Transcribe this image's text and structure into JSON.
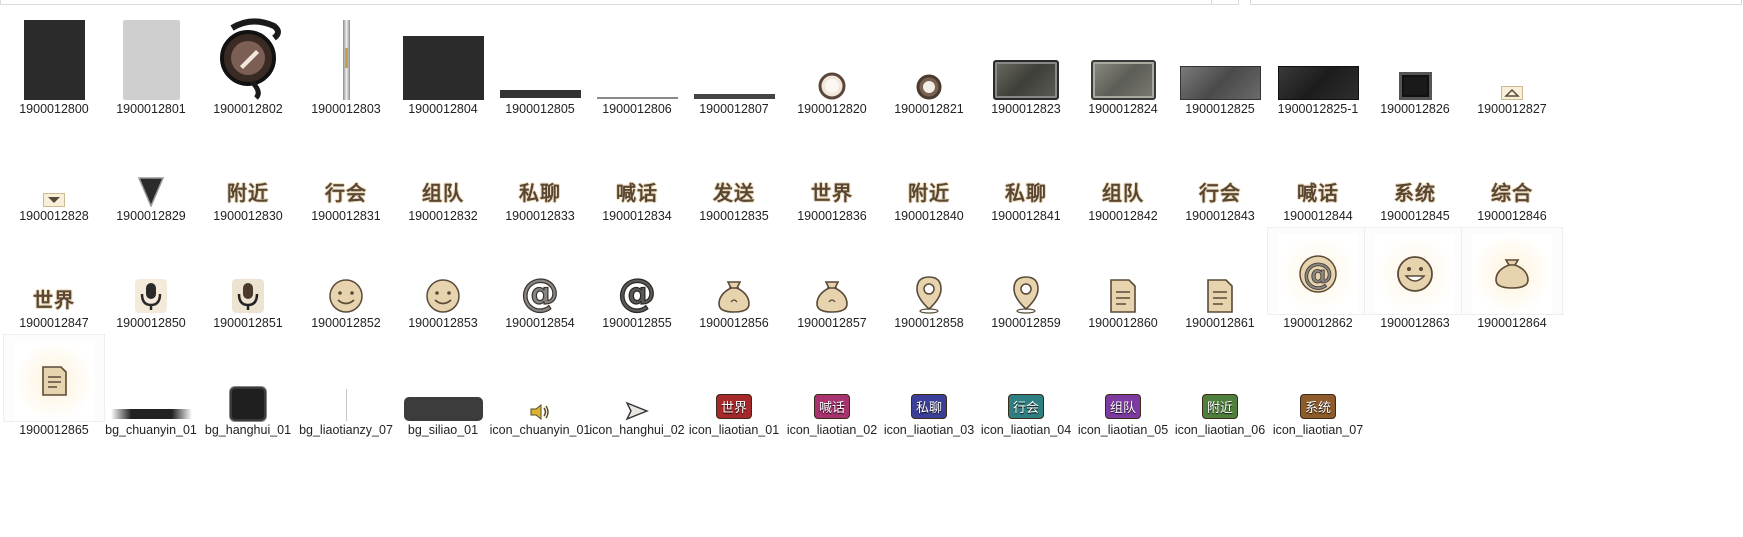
{
  "colors": {
    "dark_panel": "#2b2b2b",
    "gray_panel": "#cfcfcf",
    "beige_icon": "#e7d3ad",
    "icon_outline": "#5a4a38",
    "badge_world": "#a5282b",
    "badge_shout": "#a8336f",
    "badge_private": "#3a3f9a",
    "badge_guild": "#2e7f82",
    "badge_team": "#7d3aa1",
    "badge_nearby": "#4f7f3c",
    "badge_system": "#8e5b2a"
  },
  "files": [
    {
      "name": "1900012800",
      "kind": "dark-panel",
      "icon": "dark-square-image"
    },
    {
      "name": "1900012801",
      "kind": "gray-panel",
      "icon": "gray-square-image"
    },
    {
      "name": "1900012802",
      "kind": "orb",
      "icon": "pencil-orb-icon"
    },
    {
      "name": "1900012803",
      "kind": "vbar",
      "icon": "vertical-slider-bar-image"
    },
    {
      "name": "1900012804",
      "kind": "dark-rect",
      "icon": "dark-rectangle-image"
    },
    {
      "name": "1900012805",
      "kind": "thick-line",
      "icon": "dark-bar-image"
    },
    {
      "name": "1900012806",
      "kind": "thin-line",
      "icon": "thin-line-image"
    },
    {
      "name": "1900012807",
      "kind": "mid-line",
      "icon": "line-image"
    },
    {
      "name": "1900012820",
      "kind": "ring-light",
      "icon": "round-button-icon"
    },
    {
      "name": "1900012821",
      "kind": "ring-dark",
      "icon": "round-button-icon"
    },
    {
      "name": "1900012823",
      "kind": "plate1",
      "icon": "metal-plate-image"
    },
    {
      "name": "1900012824",
      "kind": "plate2",
      "icon": "metal-plate-image"
    },
    {
      "name": "1900012825",
      "kind": "plate3",
      "icon": "metal-plate-image"
    },
    {
      "name": "1900012825-1",
      "kind": "plate4",
      "icon": "metal-plate-image"
    },
    {
      "name": "1900012826",
      "kind": "frame",
      "icon": "square-frame-image"
    },
    {
      "name": "1900012827",
      "kind": "arrow-up",
      "icon": "arrow-up-icon"
    },
    {
      "name": "1900012828",
      "kind": "arrow-down",
      "icon": "arrow-down-icon"
    },
    {
      "name": "1900012829",
      "kind": "triangle",
      "icon": "triangle-down-icon"
    },
    {
      "name": "1900012830",
      "kind": "gold",
      "text": "附近",
      "icon": "nearby-text-image"
    },
    {
      "name": "1900012831",
      "kind": "gold",
      "text": "行会",
      "icon": "guild-text-image"
    },
    {
      "name": "1900012832",
      "kind": "gold",
      "text": "组队",
      "icon": "team-text-image"
    },
    {
      "name": "1900012833",
      "kind": "gold",
      "text": "私聊",
      "icon": "private-chat-text-image"
    },
    {
      "name": "1900012834",
      "kind": "gold",
      "text": "喊话",
      "icon": "shout-text-image"
    },
    {
      "name": "1900012835",
      "kind": "gold",
      "text": "发送",
      "icon": "send-text-image"
    },
    {
      "name": "1900012836",
      "kind": "gold",
      "text": "世界",
      "icon": "world-text-image"
    },
    {
      "name": "1900012840",
      "kind": "gold",
      "text": "附近",
      "icon": "nearby-text-image"
    },
    {
      "name": "1900012841",
      "kind": "gold",
      "text": "私聊",
      "icon": "private-chat-text-image"
    },
    {
      "name": "1900012842",
      "kind": "gold",
      "text": "组队",
      "icon": "team-text-image"
    },
    {
      "name": "1900012843",
      "kind": "gold",
      "text": "行会",
      "icon": "guild-text-image"
    },
    {
      "name": "1900012844",
      "kind": "gold",
      "text": "喊话",
      "icon": "shout-text-image"
    },
    {
      "name": "1900012845",
      "kind": "gold",
      "text": "系统",
      "icon": "system-text-image"
    },
    {
      "name": "1900012846",
      "kind": "gold",
      "text": "综合",
      "icon": "general-text-image"
    },
    {
      "name": "1900012847",
      "kind": "gold",
      "text": "世界",
      "icon": "world-text-image"
    },
    {
      "name": "1900012850",
      "kind": "mic-light",
      "icon": "microphone-icon"
    },
    {
      "name": "1900012851",
      "kind": "mic-dark",
      "icon": "microphone-icon"
    },
    {
      "name": "1900012852",
      "kind": "smile",
      "icon": "smiley-icon"
    },
    {
      "name": "1900012853",
      "kind": "smile",
      "icon": "smiley-icon"
    },
    {
      "name": "1900012854",
      "kind": "at-light",
      "icon": "at-sign-icon"
    },
    {
      "name": "1900012855",
      "kind": "at-dark",
      "icon": "at-sign-icon"
    },
    {
      "name": "1900012856",
      "kind": "bag",
      "icon": "money-bag-icon"
    },
    {
      "name": "1900012857",
      "kind": "bag",
      "icon": "money-bag-icon"
    },
    {
      "name": "1900012858",
      "kind": "pin",
      "icon": "location-pin-icon"
    },
    {
      "name": "1900012859",
      "kind": "pin",
      "icon": "location-pin-icon"
    },
    {
      "name": "1900012860",
      "kind": "doc",
      "icon": "document-icon"
    },
    {
      "name": "1900012861",
      "kind": "doc",
      "icon": "document-icon"
    },
    {
      "name": "1900012862",
      "kind": "big-at",
      "icon": "at-sign-icon",
      "selected": true
    },
    {
      "name": "1900012863",
      "kind": "big-grin",
      "icon": "grinning-face-icon",
      "selected": true
    },
    {
      "name": "1900012864",
      "kind": "big-bag",
      "icon": "money-bag-icon",
      "selected": true
    },
    {
      "name": "1900012865",
      "kind": "big-doc",
      "icon": "document-icon",
      "selected": true
    },
    {
      "name": "bg_chuanyin_01",
      "kind": "fade-bar",
      "icon": "fade-bar-image"
    },
    {
      "name": "bg_hanghui_01",
      "kind": "dark-box",
      "icon": "dark-box-image"
    },
    {
      "name": "bg_liaotianzy_07",
      "kind": "hairline",
      "icon": "vertical-line-image"
    },
    {
      "name": "bg_siliao_01",
      "kind": "pill",
      "icon": "rounded-panel-image"
    },
    {
      "name": "icon_chuanyin_01",
      "kind": "speaker",
      "icon": "speaker-icon"
    },
    {
      "name": "icon_hanghui_02",
      "kind": "send",
      "icon": "send-arrow-icon"
    },
    {
      "name": "icon_liaotian_01",
      "kind": "badge",
      "text": "世界",
      "color": "#a5282b",
      "icon": "world-badge-icon"
    },
    {
      "name": "icon_liaotian_02",
      "kind": "badge",
      "text": "喊话",
      "color": "#a8336f",
      "icon": "shout-badge-icon"
    },
    {
      "name": "icon_liaotian_03",
      "kind": "badge",
      "text": "私聊",
      "color": "#3a3f9a",
      "icon": "private-chat-badge-icon"
    },
    {
      "name": "icon_liaotian_04",
      "kind": "badge",
      "text": "行会",
      "color": "#2e7f82",
      "icon": "guild-badge-icon"
    },
    {
      "name": "icon_liaotian_05",
      "kind": "badge",
      "text": "组队",
      "color": "#7d3aa1",
      "icon": "team-badge-icon"
    },
    {
      "name": "icon_liaotian_06",
      "kind": "badge",
      "text": "附近",
      "color": "#4f7f3c",
      "icon": "nearby-badge-icon"
    },
    {
      "name": "icon_liaotian_07",
      "kind": "badge",
      "text": "系统",
      "color": "#8e5b2a",
      "icon": "system-badge-icon"
    }
  ]
}
